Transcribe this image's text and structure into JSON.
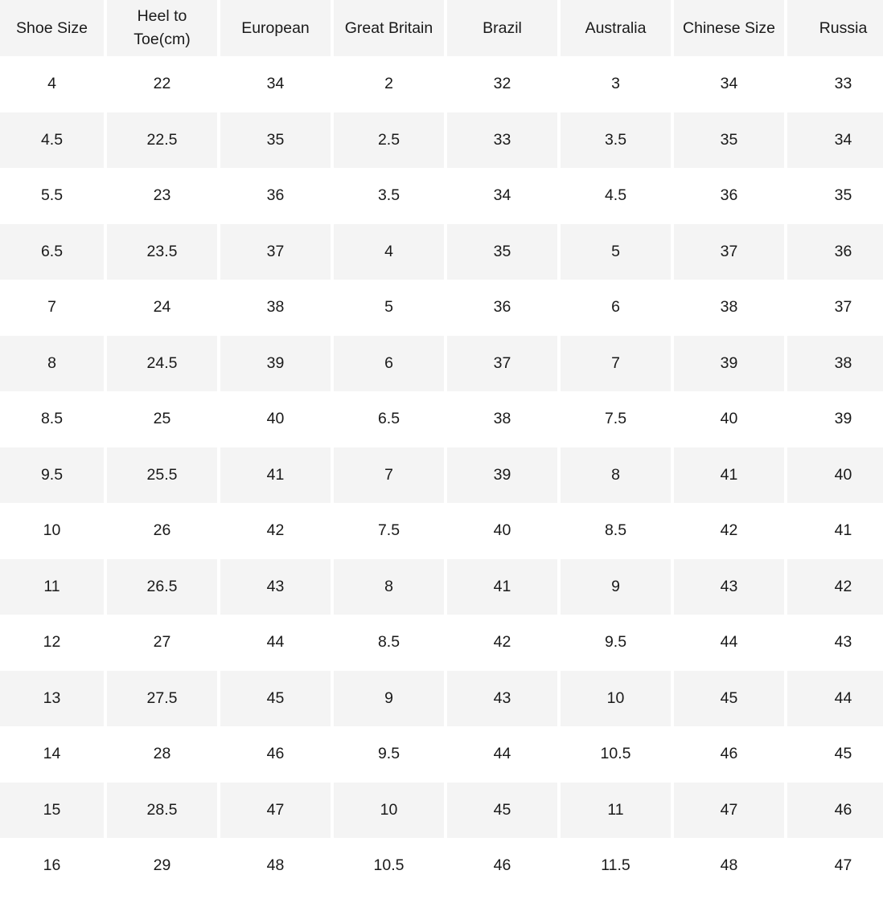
{
  "table": {
    "columns": [
      "Shoe Size",
      "Heel to Toe(cm)",
      "European",
      "Great Britain",
      "Brazil",
      "Australia",
      "Chinese Size",
      "Russia"
    ],
    "rows": [
      [
        "4",
        "22",
        "34",
        "2",
        "32",
        "3",
        "34",
        "33"
      ],
      [
        "4.5",
        "22.5",
        "35",
        "2.5",
        "33",
        "3.5",
        "35",
        "34"
      ],
      [
        "5.5",
        "23",
        "36",
        "3.5",
        "34",
        "4.5",
        "36",
        "35"
      ],
      [
        "6.5",
        "23.5",
        "37",
        "4",
        "35",
        "5",
        "37",
        "36"
      ],
      [
        "7",
        "24",
        "38",
        "5",
        "36",
        "6",
        "38",
        "37"
      ],
      [
        "8",
        "24.5",
        "39",
        "6",
        "37",
        "7",
        "39",
        "38"
      ],
      [
        "8.5",
        "25",
        "40",
        "6.5",
        "38",
        "7.5",
        "40",
        "39"
      ],
      [
        "9.5",
        "25.5",
        "41",
        "7",
        "39",
        "8",
        "41",
        "40"
      ],
      [
        "10",
        "26",
        "42",
        "7.5",
        "40",
        "8.5",
        "42",
        "41"
      ],
      [
        "11",
        "26.5",
        "43",
        "8",
        "41",
        "9",
        "43",
        "42"
      ],
      [
        "12",
        "27",
        "44",
        "8.5",
        "42",
        "9.5",
        "44",
        "43"
      ],
      [
        "13",
        "27.5",
        "45",
        "9",
        "43",
        "10",
        "45",
        "44"
      ],
      [
        "14",
        "28",
        "46",
        "9.5",
        "44",
        "10.5",
        "46",
        "45"
      ],
      [
        "15",
        "28.5",
        "47",
        "10",
        "45",
        "11",
        "47",
        "46"
      ],
      [
        "16",
        "29",
        "48",
        "10.5",
        "46",
        "11.5",
        "48",
        "47"
      ]
    ]
  },
  "style": {
    "header_background": "#f4f4f4",
    "stripe_background": "#f4f4f4",
    "row_background": "#ffffff",
    "text_color": "#1a1a1a"
  }
}
